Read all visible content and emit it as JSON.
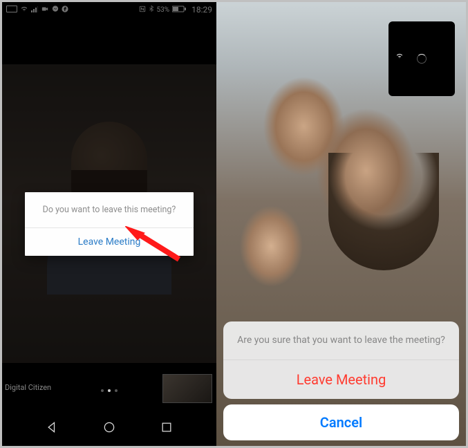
{
  "left": {
    "status": {
      "battery_pct": "53%",
      "time": "18:29"
    },
    "dialog": {
      "message": "Do you want to leave this meeting?",
      "leave_label": "Leave Meeting"
    },
    "watermark": "Digital Citizen"
  },
  "right": {
    "sheet": {
      "message": "Are you sure that you want to leave the meeting?",
      "leave_label": "Leave Meeting",
      "cancel_label": "Cancel"
    }
  }
}
